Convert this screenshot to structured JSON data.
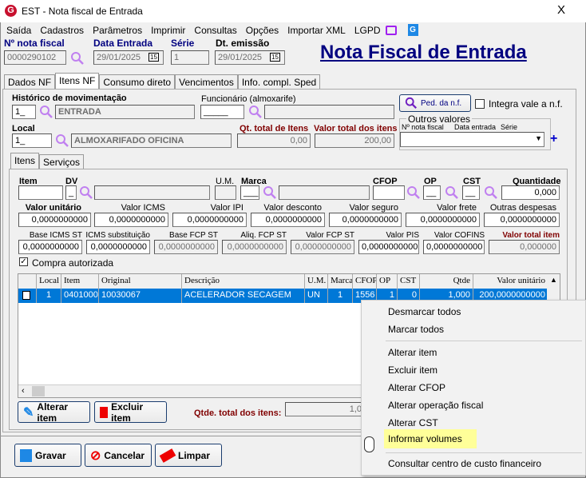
{
  "window": {
    "title": "EST - Nota fiscal de Entrada",
    "close": "X"
  },
  "menu": [
    "Saída",
    "Cadastros",
    "Parâmetros",
    "Imprimir",
    "Consultas",
    "Opções",
    "Importar XML",
    "LGPD"
  ],
  "header": {
    "nf_label": "Nº nota fiscal",
    "nf_value": "0000290102",
    "data_entrada_label": "Data Entrada",
    "data_entrada": "29/01/2025",
    "serie_label": "Série",
    "serie": "1",
    "dt_emissao_label": "Dt. emissão",
    "dt_emissao": "29/01/2025",
    "calendar": "15",
    "page_title": "Nota Fiscal de Entrada"
  },
  "tabs": [
    "Dados NF",
    "Itens NF",
    "Consumo direto",
    "Vencimentos",
    "Info. compl. Sped"
  ],
  "form": {
    "historico_label": "Histórico de movimentação",
    "historico_code": "1_",
    "historico_desc": "ENTRADA",
    "funcionario_label": "Funcionário (almoxarife)",
    "funcionario_code": "_____",
    "ped_button": "Ped. da n.f.",
    "integra_label": "Integra vale a n.f.",
    "local_label": "Local",
    "local_code": "1_",
    "local_desc": "ALMOXARIFADO OFICINA",
    "qt_total_label": "Qt. total de Itens",
    "qt_total": "0,00",
    "valor_total_label": "Valor total dos itens",
    "valor_total": "200,00",
    "outros_label": "Outros valores",
    "outros_cols": [
      "Nº nota fiscal",
      "Data entrada",
      "Série"
    ]
  },
  "subtabs": [
    "Itens",
    "Serviços"
  ],
  "item": {
    "item_label": "Item",
    "dv_label": "DV",
    "dv": "_",
    "um_label": "U.M.",
    "marca_label": "Marca",
    "marca": "___",
    "cfop_label": "CFOP",
    "op_label": "OP",
    "op": "__",
    "cst_label": "CST",
    "cst": "__",
    "quantidade_label": "Quantidade",
    "quantidade": "0,000"
  },
  "values_row1": [
    {
      "label": "Valor unitário",
      "value": "0,0000000000"
    },
    {
      "label": "Valor ICMS",
      "value": "0,0000000000"
    },
    {
      "label": "Valor IPI",
      "value": "0,0000000000"
    },
    {
      "label": "Valor desconto",
      "value": "0,0000000000"
    },
    {
      "label": "Valor seguro",
      "value": "0,0000000000"
    },
    {
      "label": "Valor frete",
      "value": "0,0000000000"
    },
    {
      "label": "Outras despesas",
      "value": "0,0000000000"
    }
  ],
  "values_row2": [
    {
      "label": "Base ICMS ST",
      "value": "0,0000000000"
    },
    {
      "label": "ICMS substituição",
      "value": "0,0000000000"
    },
    {
      "label": "Base FCP ST",
      "value": "0,0000000000"
    },
    {
      "label": "Aliq. FCP ST",
      "value": "0,0000000000"
    },
    {
      "label": "Valor FCP ST",
      "value": "0,0000000000"
    },
    {
      "label": "Valor PIS",
      "value": "0,0000000000"
    },
    {
      "label": "Valor COFINS",
      "value": "0,0000000000"
    },
    {
      "label": "Valor total item",
      "value": "0,000000"
    }
  ],
  "compra_autorizada": "Compra autorizada",
  "table": {
    "columns": [
      "",
      "Local",
      "Item",
      "Original",
      "Descrição",
      "U.M.",
      "Marca",
      "CFOP",
      "OP",
      "CST",
      "Qtde",
      "Valor unitário"
    ],
    "rows": [
      [
        "",
        "1",
        "04010001",
        "10030067",
        "ACELERADOR SECAGEM",
        "UN",
        "1",
        "1556",
        "1",
        "0",
        "1,000",
        "200,0000000000"
      ]
    ]
  },
  "actions": {
    "alterar": "Alterar item",
    "excluir": "Excluir item",
    "qtde_total_label": "Qtde. total dos itens:",
    "qtde_total": "1,0"
  },
  "footer": {
    "gravar": "Gravar",
    "cancelar": "Cancelar",
    "limpar": "Limpar"
  },
  "context_menu": [
    "Desmarcar todos",
    "Marcar todos",
    "Alterar item",
    "Excluir item",
    "Alterar CFOP",
    "Alterar operação fiscal",
    "Alterar CST",
    "Informar volumes",
    "Consultar centro de custo financeiro"
  ],
  "colors": {
    "highlight": "#ffff99",
    "selection": "#0078d7",
    "title_blue": "#000080",
    "label_red": "#800000"
  }
}
